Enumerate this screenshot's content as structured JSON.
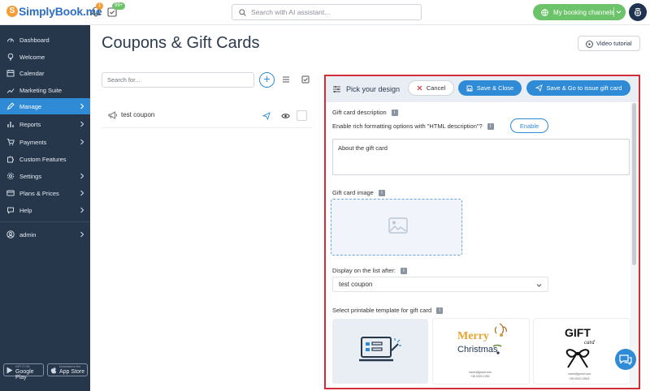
{
  "app": {
    "logo_text": "SimplyBook.me",
    "notifications_badge": "1",
    "tasks_badge": "99+",
    "search_placeholder": "Search with AI assistant...",
    "booking_channels_label": "My booking channels"
  },
  "sidebar": {
    "items": [
      {
        "label": "Dashboard",
        "icon": "dashboard-icon",
        "arrow": false,
        "active": false
      },
      {
        "label": "Welcome",
        "icon": "bulb-icon",
        "arrow": false,
        "active": false
      },
      {
        "label": "Calendar",
        "icon": "calendar-icon",
        "arrow": false,
        "active": false
      },
      {
        "label": "Marketing Suite",
        "icon": "chart-icon",
        "arrow": false,
        "active": false
      },
      {
        "label": "Manage",
        "icon": "pencil-icon",
        "arrow": true,
        "active": true
      },
      {
        "label": "Reports",
        "icon": "bar-chart-icon",
        "arrow": true,
        "active": false
      },
      {
        "label": "Payments",
        "icon": "cart-icon",
        "arrow": true,
        "active": false
      },
      {
        "label": "Custom Features",
        "icon": "puzzle-icon",
        "arrow": false,
        "active": false
      },
      {
        "label": "Settings",
        "icon": "gear-icon",
        "arrow": true,
        "active": false
      },
      {
        "label": "Plans & Prices",
        "icon": "card-icon",
        "arrow": true,
        "active": false
      },
      {
        "label": "Help",
        "icon": "chat-icon",
        "arrow": true,
        "active": false
      },
      {
        "label": "admin",
        "icon": "user-icon",
        "arrow": true,
        "active": false
      }
    ],
    "google_play_small": "GET IT ON",
    "google_play_label": "Google Play",
    "app_store_small": "Download on the",
    "app_store_label": "App Store"
  },
  "page": {
    "title": "Coupons & Gift Cards",
    "video_tutorial": "Video tutorial",
    "list_search_placeholder": "Search for...",
    "coupon_name": "test coupon"
  },
  "panel": {
    "title": "Pick your design",
    "cancel": "Cancel",
    "save_close": "Save & Close",
    "save_issue": "Save & Go to issue gift card",
    "desc_label": "Gift card description",
    "rich_label": "Enable rich formatting options with \"HTML description\"?",
    "enable": "Enable",
    "desc_value": "About the gift card",
    "image_label": "Gift card image",
    "display_label": "Display on the list after:",
    "display_value": "test coupon",
    "template_label": "Select printable template for gift card",
    "tpl_merry": "Merry",
    "tpl_christmas": "Christmas",
    "tpl_gift": "GIFT",
    "tpl_card": "card",
    "tpl_email": "name@gmail.com",
    "tpl_phone": "+38 0000 1256",
    "tpl_phone2": "+38 0000 12563"
  },
  "colors": {
    "sidebar_bg": "#26364b",
    "accent": "#2f8bd6",
    "green": "#6cc36a",
    "frame": "#d12e3a"
  }
}
